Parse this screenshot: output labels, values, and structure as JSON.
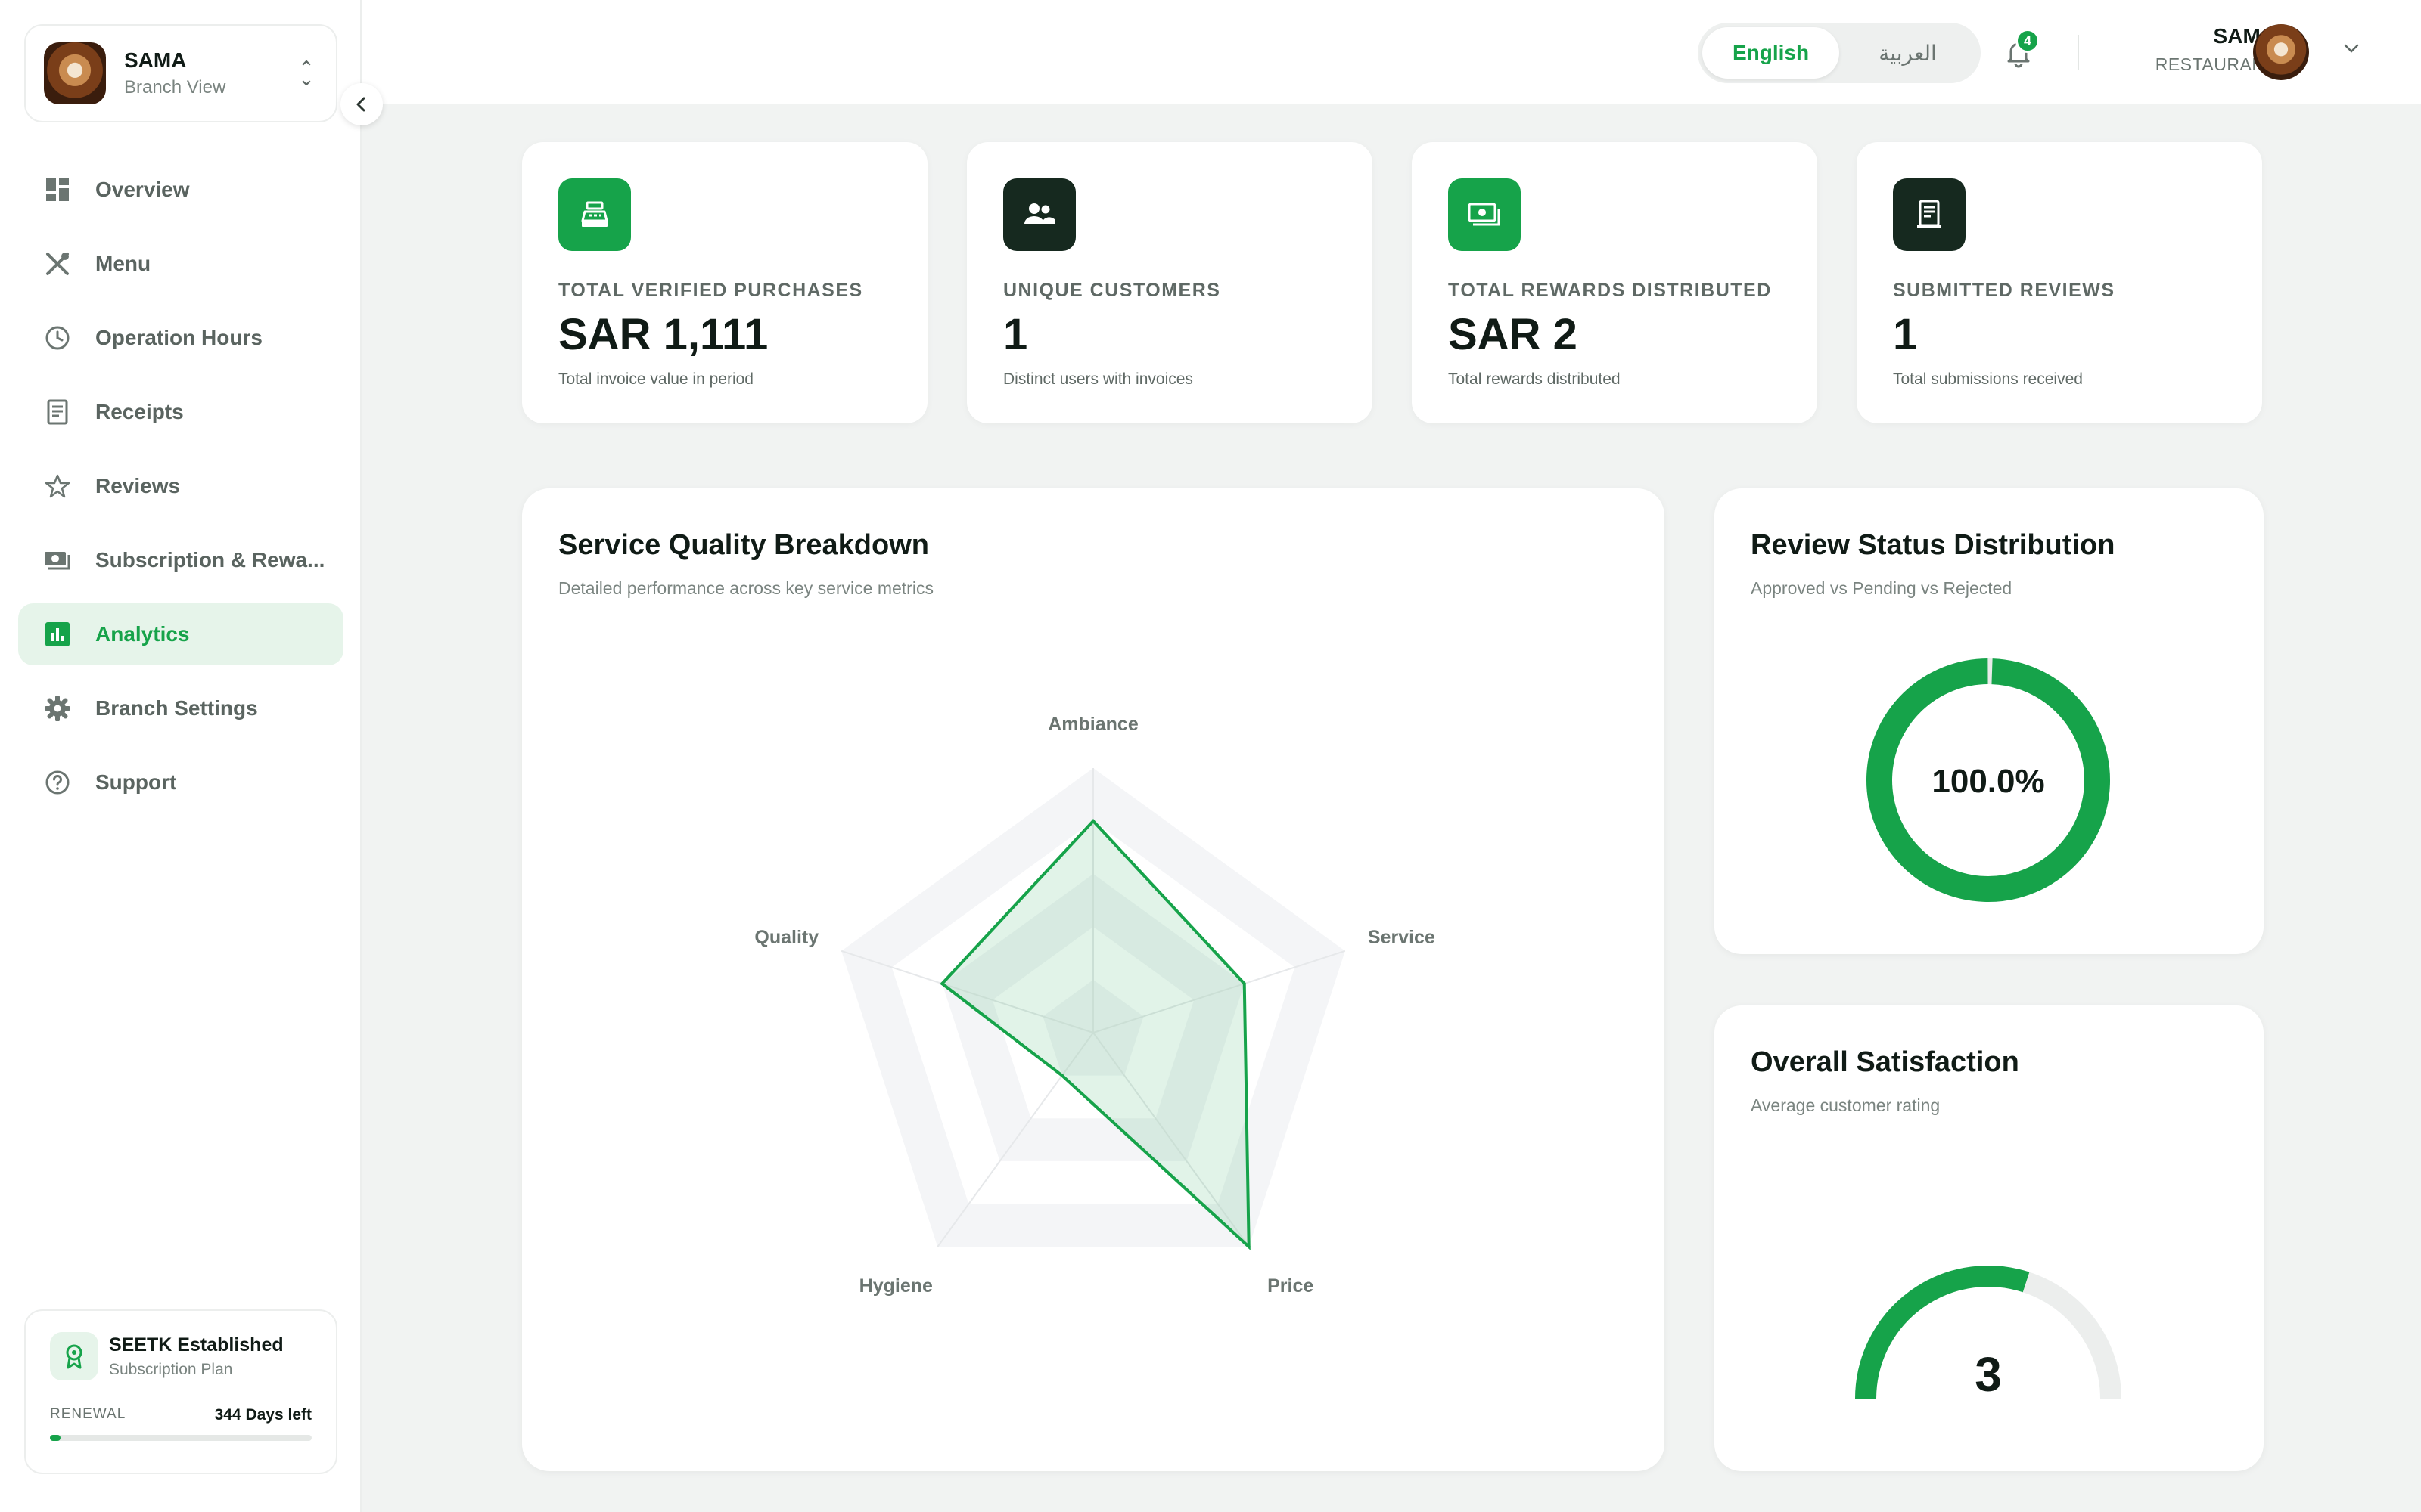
{
  "branch": {
    "name": "SAMA",
    "subtitle": "Branch View"
  },
  "nav": [
    {
      "label": "Overview",
      "icon": "grid-icon"
    },
    {
      "label": "Menu",
      "icon": "utensils-icon"
    },
    {
      "label": "Operation Hours",
      "icon": "clock-icon"
    },
    {
      "label": "Receipts",
      "icon": "receipt-icon"
    },
    {
      "label": "Reviews",
      "icon": "star-icon"
    },
    {
      "label": "Subscription & Rewa...",
      "icon": "money-icon"
    },
    {
      "label": "Analytics",
      "icon": "bar-chart-icon",
      "active": true
    },
    {
      "label": "Branch Settings",
      "icon": "gear-icon"
    },
    {
      "label": "Support",
      "icon": "help-circle-icon"
    }
  ],
  "plan": {
    "name": "SEETK Established",
    "subtitle": "Subscription Plan",
    "renewal_label": "RENEWAL",
    "days_left": "344 Days left",
    "progress_fraction": 0.04
  },
  "header": {
    "lang_english": "English",
    "lang_arabic": "العربية",
    "notifications": "4",
    "user_name": "SAMA",
    "user_role": "RESTAURANT"
  },
  "stats": [
    {
      "label": "TOTAL VERIFIED PURCHASES",
      "value": "SAR 1,111",
      "desc": "Total invoice value in period",
      "icon": "cash-register-icon",
      "tone": "green"
    },
    {
      "label": "UNIQUE CUSTOMERS",
      "value": "1",
      "desc": "Distinct users with invoices",
      "icon": "users-icon",
      "tone": "dark"
    },
    {
      "label": "TOTAL REWARDS DISTRIBUTED",
      "value": "SAR 2",
      "desc": "Total rewards distributed",
      "icon": "banknote-icon",
      "tone": "green"
    },
    {
      "label": "SUBMITTED REVIEWS",
      "value": "1",
      "desc": "Total submissions received",
      "icon": "receipt-icon",
      "tone": "dark"
    }
  ],
  "service_quality": {
    "title": "Service Quality Breakdown",
    "subtitle": "Detailed performance across key service metrics"
  },
  "review_status": {
    "title": "Review Status Distribution",
    "subtitle": "Approved vs Pending vs Rejected",
    "center_label": "100.0%"
  },
  "satisfaction": {
    "title": "Overall Satisfaction",
    "subtitle": "Average customer rating",
    "value": "3"
  },
  "chart_data": [
    {
      "type": "radar",
      "categories": [
        "Ambiance",
        "Service",
        "Price",
        "Hygiene",
        "Quality"
      ],
      "values": [
        4,
        3,
        5,
        1,
        3
      ],
      "max": 5,
      "color": "#16a34a"
    },
    {
      "type": "pie",
      "style": "donut",
      "values": [
        100
      ],
      "color": "#16a34a"
    },
    {
      "type": "gauge",
      "value": 3,
      "max": 5,
      "color": "#16a34a"
    }
  ],
  "colors": {
    "accent": "#16a34a",
    "dark": "#16291f"
  }
}
